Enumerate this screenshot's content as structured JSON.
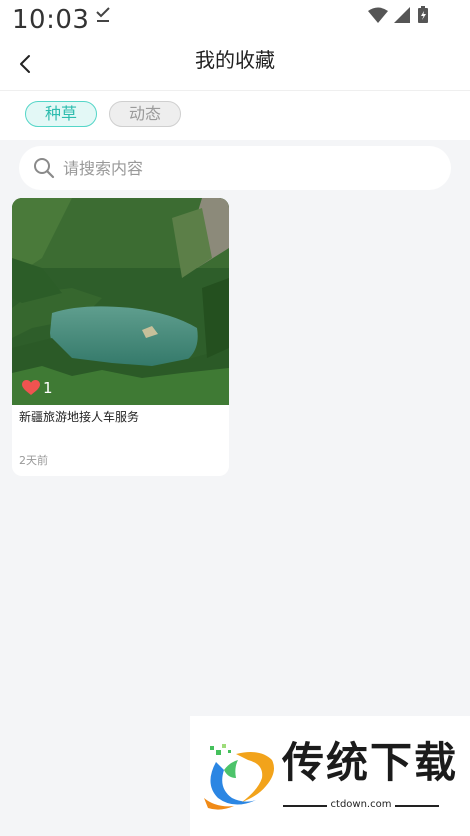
{
  "status_bar": {
    "time": "10:03"
  },
  "header": {
    "title": "我的收藏"
  },
  "tabs": [
    {
      "label": "种草",
      "active": true
    },
    {
      "label": "动态",
      "active": false
    }
  ],
  "search": {
    "placeholder": "请搜索内容",
    "value": ""
  },
  "posts": [
    {
      "title": "新疆旅游地接人车服务",
      "likes": "1",
      "time": "2天前"
    }
  ],
  "watermark": {
    "brand": "传统下载",
    "url": "ctdown.com"
  },
  "colors": {
    "accent": "#2dbcae",
    "accent_bg": "#e3f8f6",
    "heart": "#ef5350",
    "page_bg": "#f4f5f7"
  },
  "icons": {
    "back": "chevron-left-icon",
    "search": "search-icon",
    "like": "heart-icon"
  }
}
